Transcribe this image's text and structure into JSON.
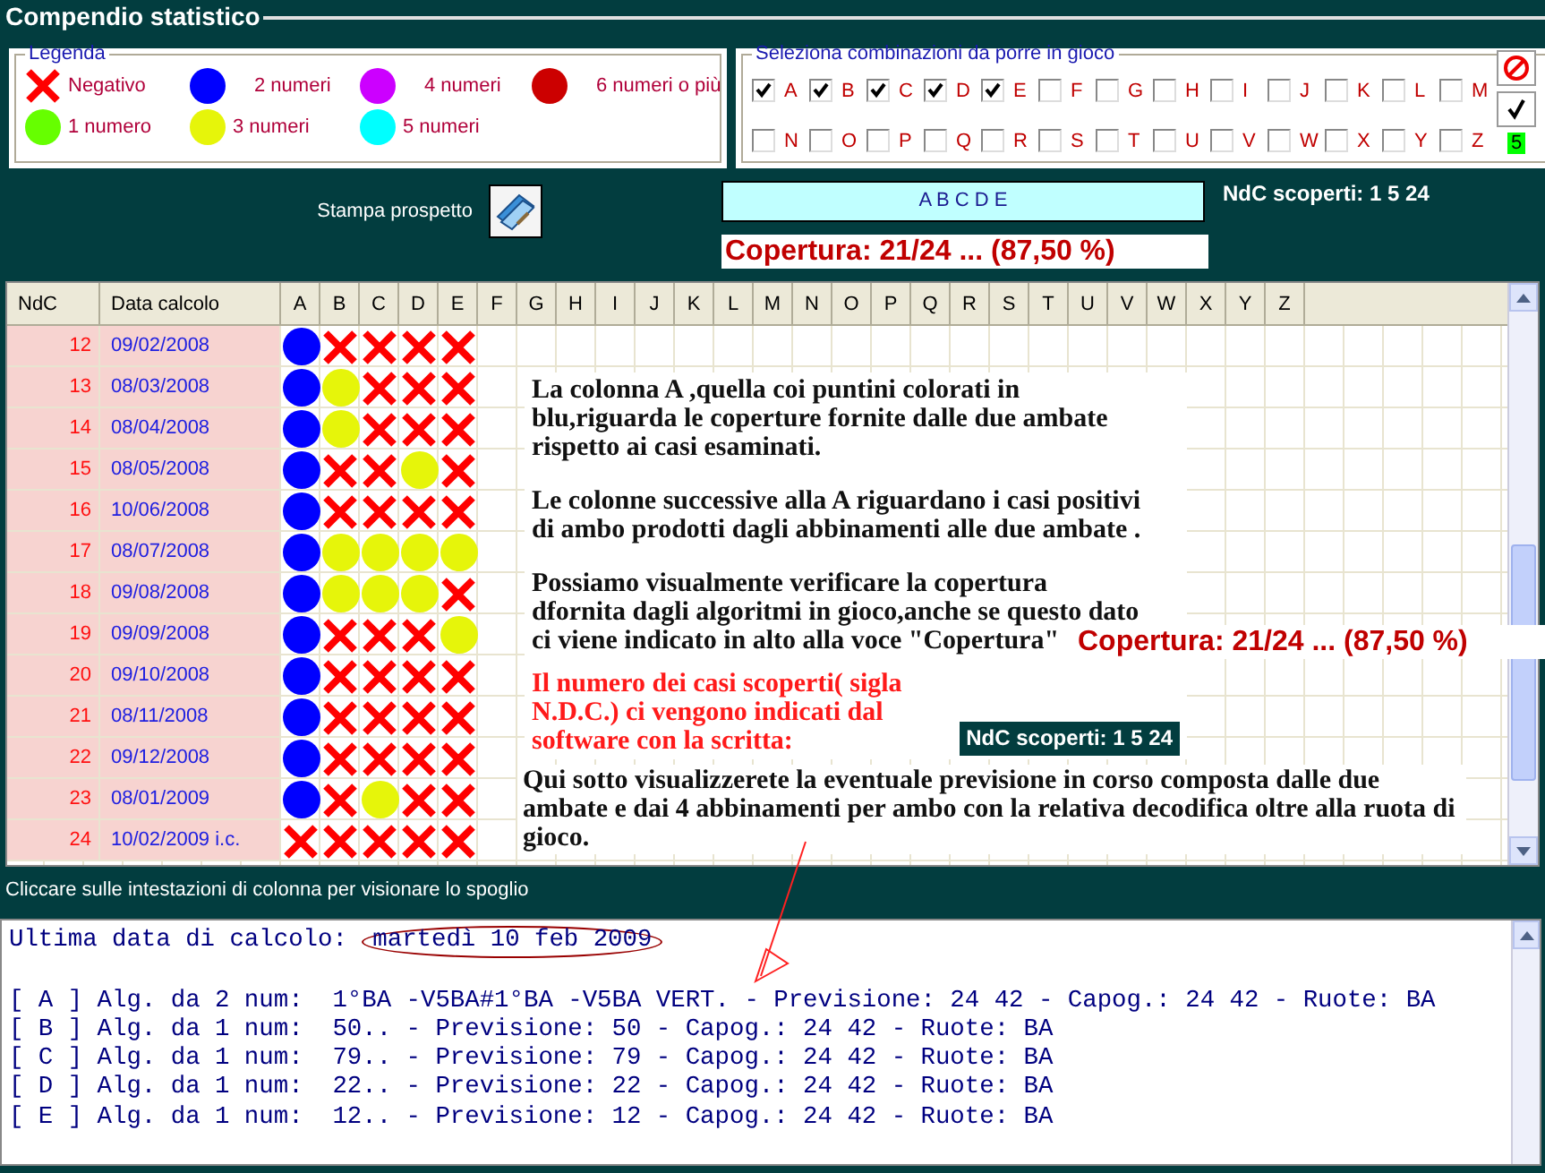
{
  "window": {
    "title": "Compendio statistico"
  },
  "legend": {
    "title": "Legenda",
    "items": [
      {
        "kind": "cross",
        "color": "#ff0000",
        "label": "Negativo"
      },
      {
        "kind": "dot",
        "color": "#0000ff",
        "label": "2 numeri"
      },
      {
        "kind": "dot",
        "color": "#cc00ff",
        "label": "4 numeri"
      },
      {
        "kind": "dot",
        "color": "#cc0000",
        "label": "6 numeri o più"
      },
      {
        "kind": "dot",
        "color": "#66ff00",
        "label": "1 numero"
      },
      {
        "kind": "dot",
        "color": "#e6f50a",
        "label": "3 numeri"
      },
      {
        "kind": "dot",
        "color": "#00ffff",
        "label": "5 numeri"
      }
    ]
  },
  "selection": {
    "title": "Seleziona combinazioni da porre in gioco",
    "options": [
      {
        "label": "A",
        "checked": true
      },
      {
        "label": "B",
        "checked": true
      },
      {
        "label": "C",
        "checked": true
      },
      {
        "label": "D",
        "checked": true
      },
      {
        "label": "E",
        "checked": true
      },
      {
        "label": "F",
        "checked": false
      },
      {
        "label": "G",
        "checked": false
      },
      {
        "label": "H",
        "checked": false
      },
      {
        "label": "I",
        "checked": false
      },
      {
        "label": "J",
        "checked": false
      },
      {
        "label": "K",
        "checked": false
      },
      {
        "label": "L",
        "checked": false
      },
      {
        "label": "M",
        "checked": false
      },
      {
        "label": "N",
        "checked": false
      },
      {
        "label": "O",
        "checked": false
      },
      {
        "label": "P",
        "checked": false
      },
      {
        "label": "Q",
        "checked": false
      },
      {
        "label": "R",
        "checked": false
      },
      {
        "label": "S",
        "checked": false
      },
      {
        "label": "T",
        "checked": false
      },
      {
        "label": "U",
        "checked": false
      },
      {
        "label": "V",
        "checked": false
      },
      {
        "label": "W",
        "checked": false
      },
      {
        "label": "X",
        "checked": false
      },
      {
        "label": "Y",
        "checked": false
      },
      {
        "label": "Z",
        "checked": false
      }
    ],
    "count": "5"
  },
  "print": {
    "label": "Stampa prospetto"
  },
  "combination": "A B C D E",
  "uncovered": "NdC scoperti: 1 5 24",
  "coverage": "Copertura: 21/24 ... (87,50 %)",
  "table": {
    "columns": [
      "NdC",
      "Data calcolo",
      "A",
      "B",
      "C",
      "D",
      "E",
      "F",
      "G",
      "H",
      "I",
      "J",
      "K",
      "L",
      "M",
      "N",
      "O",
      "P",
      "Q",
      "R",
      "S",
      "T",
      "U",
      "V",
      "W",
      "X",
      "Y",
      "Z"
    ],
    "rows": [
      {
        "ndc": "12",
        "date": "09/02/2008",
        "marks": [
          {
            "kind": "dot",
            "color": "#0000ff"
          },
          {
            "kind": "cross",
            "color": "#ff0000"
          },
          {
            "kind": "cross",
            "color": "#ff0000"
          },
          {
            "kind": "cross",
            "color": "#ff0000"
          },
          {
            "kind": "cross",
            "color": "#ff0000"
          }
        ]
      },
      {
        "ndc": "13",
        "date": "08/03/2008",
        "marks": [
          {
            "kind": "dot",
            "color": "#0000ff"
          },
          {
            "kind": "dot",
            "color": "#e6f50a"
          },
          {
            "kind": "cross",
            "color": "#ff0000"
          },
          {
            "kind": "cross",
            "color": "#ff0000"
          },
          {
            "kind": "cross",
            "color": "#ff0000"
          }
        ]
      },
      {
        "ndc": "14",
        "date": "08/04/2008",
        "marks": [
          {
            "kind": "dot",
            "color": "#0000ff"
          },
          {
            "kind": "dot",
            "color": "#e6f50a"
          },
          {
            "kind": "cross",
            "color": "#ff0000"
          },
          {
            "kind": "cross",
            "color": "#ff0000"
          },
          {
            "kind": "cross",
            "color": "#ff0000"
          }
        ]
      },
      {
        "ndc": "15",
        "date": "08/05/2008",
        "marks": [
          {
            "kind": "dot",
            "color": "#0000ff"
          },
          {
            "kind": "cross",
            "color": "#ff0000"
          },
          {
            "kind": "cross",
            "color": "#ff0000"
          },
          {
            "kind": "dot",
            "color": "#e6f50a"
          },
          {
            "kind": "cross",
            "color": "#ff0000"
          }
        ]
      },
      {
        "ndc": "16",
        "date": "10/06/2008",
        "marks": [
          {
            "kind": "dot",
            "color": "#0000ff"
          },
          {
            "kind": "cross",
            "color": "#ff0000"
          },
          {
            "kind": "cross",
            "color": "#ff0000"
          },
          {
            "kind": "cross",
            "color": "#ff0000"
          },
          {
            "kind": "cross",
            "color": "#ff0000"
          }
        ]
      },
      {
        "ndc": "17",
        "date": "08/07/2008",
        "marks": [
          {
            "kind": "dot",
            "color": "#0000ff"
          },
          {
            "kind": "dot",
            "color": "#e6f50a"
          },
          {
            "kind": "dot",
            "color": "#e6f50a"
          },
          {
            "kind": "dot",
            "color": "#e6f50a"
          },
          {
            "kind": "dot",
            "color": "#e6f50a"
          }
        ]
      },
      {
        "ndc": "18",
        "date": "09/08/2008",
        "marks": [
          {
            "kind": "dot",
            "color": "#0000ff"
          },
          {
            "kind": "dot",
            "color": "#e6f50a"
          },
          {
            "kind": "dot",
            "color": "#e6f50a"
          },
          {
            "kind": "dot",
            "color": "#e6f50a"
          },
          {
            "kind": "cross",
            "color": "#ff0000"
          }
        ]
      },
      {
        "ndc": "19",
        "date": "09/09/2008",
        "marks": [
          {
            "kind": "dot",
            "color": "#0000ff"
          },
          {
            "kind": "cross",
            "color": "#ff0000"
          },
          {
            "kind": "cross",
            "color": "#ff0000"
          },
          {
            "kind": "cross",
            "color": "#ff0000"
          },
          {
            "kind": "dot",
            "color": "#e6f50a"
          }
        ]
      },
      {
        "ndc": "20",
        "date": "09/10/2008",
        "marks": [
          {
            "kind": "dot",
            "color": "#0000ff"
          },
          {
            "kind": "cross",
            "color": "#ff0000"
          },
          {
            "kind": "cross",
            "color": "#ff0000"
          },
          {
            "kind": "cross",
            "color": "#ff0000"
          },
          {
            "kind": "cross",
            "color": "#ff0000"
          }
        ]
      },
      {
        "ndc": "21",
        "date": "08/11/2008",
        "marks": [
          {
            "kind": "dot",
            "color": "#0000ff"
          },
          {
            "kind": "cross",
            "color": "#ff0000"
          },
          {
            "kind": "cross",
            "color": "#ff0000"
          },
          {
            "kind": "cross",
            "color": "#ff0000"
          },
          {
            "kind": "cross",
            "color": "#ff0000"
          }
        ]
      },
      {
        "ndc": "22",
        "date": "09/12/2008",
        "marks": [
          {
            "kind": "dot",
            "color": "#0000ff"
          },
          {
            "kind": "cross",
            "color": "#ff0000"
          },
          {
            "kind": "cross",
            "color": "#ff0000"
          },
          {
            "kind": "cross",
            "color": "#ff0000"
          },
          {
            "kind": "cross",
            "color": "#ff0000"
          }
        ]
      },
      {
        "ndc": "23",
        "date": "08/01/2009",
        "marks": [
          {
            "kind": "dot",
            "color": "#0000ff"
          },
          {
            "kind": "cross",
            "color": "#ff0000"
          },
          {
            "kind": "dot",
            "color": "#e6f50a"
          },
          {
            "kind": "cross",
            "color": "#ff0000"
          },
          {
            "kind": "cross",
            "color": "#ff0000"
          }
        ]
      },
      {
        "ndc": "24",
        "date": "10/02/2009 i.c.",
        "marks": [
          {
            "kind": "cross",
            "color": "#ff0000"
          },
          {
            "kind": "cross",
            "color": "#ff0000"
          },
          {
            "kind": "cross",
            "color": "#ff0000"
          },
          {
            "kind": "cross",
            "color": "#ff0000"
          },
          {
            "kind": "cross",
            "color": "#ff0000"
          }
        ]
      }
    ]
  },
  "notes": {
    "paragraphs": [
      "La colonna A ,quella coi puntini colorati in blu,riguarda le coperture fornite dalle due ambate rispetto ai casi esaminati.",
      "Le colonne successive alla A riguardano i casi positivi di ambo prodotti dagli abbinamenti alle due ambate .",
      "Possiamo visualmente verificare la copertura dfornita dagli algoritmi in gioco,anche se questo dato",
      "ci viene indicato in alto alla voce \"Copertura\""
    ],
    "coverage": "Copertura: 21/24 ... (87,50 %)",
    "warning": "Il numero dei casi scoperti( sigla N.D.C.) ci vengono indicati dal software con la scritta:",
    "uncovered": "NdC scoperti: 1 5 24",
    "footer": "Qui sotto visualizzerete la eventuale previsione in corso composta dalle due ambate e dai 4 abbinamenti per ambo con la relativa decodifica oltre alla ruota di gioco."
  },
  "hint": "Cliccare sulle intestazioni di colonna per visionare lo spoglio",
  "output": {
    "label": "Ultima data di calcolo:",
    "date": "martedì 10 feb 2009",
    "lines": [
      "[ A ] Alg. da 2 num:  1°BA -V5BA#1°BA -V5BA VERT. - Previsione: 24 42 - Capog.: 24 42 - Ruote: BA",
      "[ B ] Alg. da 1 num:  50.. - Previsione: 50 - Capog.: 24 42 - Ruote: BA",
      "[ C ] Alg. da 1 num:  79.. - Previsione: 79 - Capog.: 24 42 - Ruote: BA",
      "[ D ] Alg. da 1 num:  22.. - Previsione: 22 - Capog.: 24 42 - Ruote: BA",
      "[ E ] Alg. da 1 num:  12.. - Previsione: 12 - Capog.: 24 42 - Ruote: BA"
    ]
  }
}
